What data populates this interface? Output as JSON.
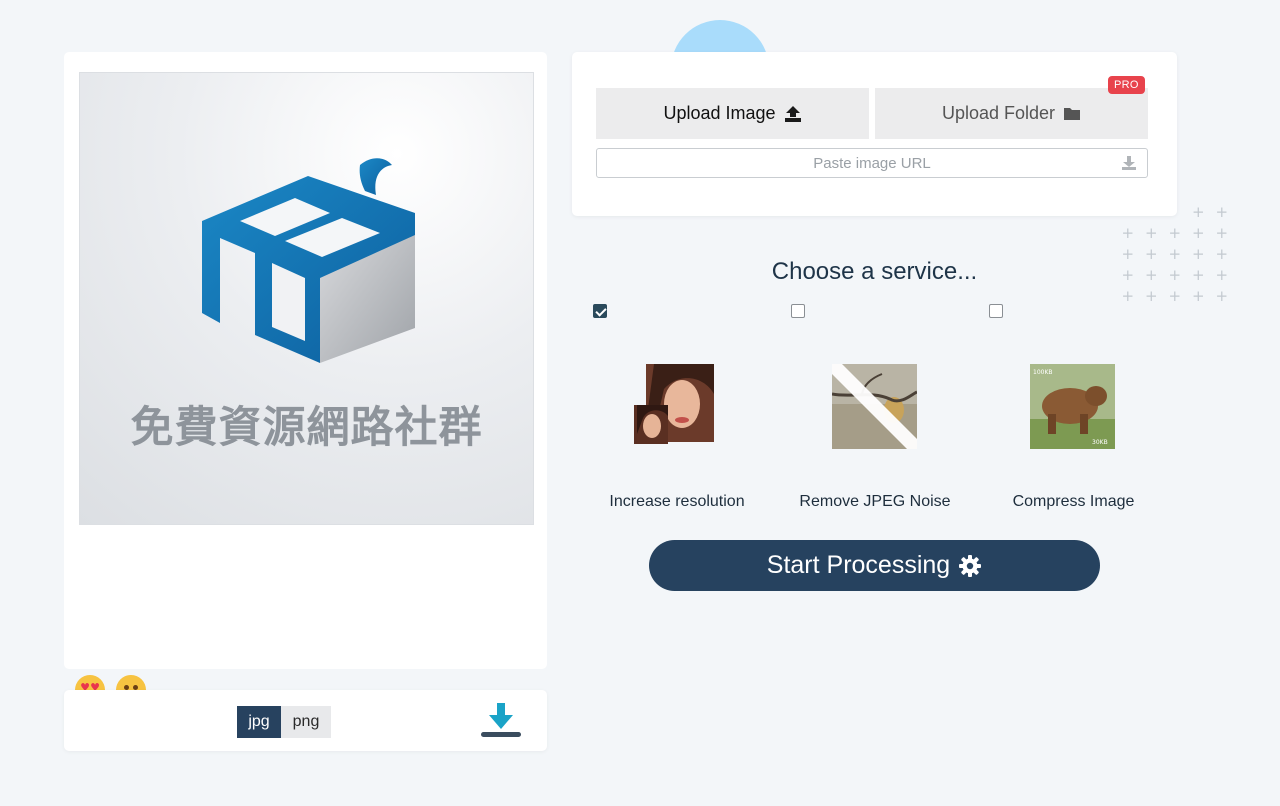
{
  "upload": {
    "image_label": "Upload Image",
    "folder_label": "Upload Folder",
    "pro_badge": "PRO",
    "url_placeholder": "Paste image URL",
    "url_value": ""
  },
  "preview": {
    "caption": "免費資源網路社群"
  },
  "reactions": {
    "love_icon": "heart-eyes-emoji-icon",
    "sad_icon": "slightly-frowning-emoji-icon"
  },
  "format": {
    "options": [
      "jpg",
      "png"
    ],
    "selected": "jpg"
  },
  "services": {
    "title": "Choose a service...",
    "items": [
      {
        "label": "Increase resolution",
        "checked": true
      },
      {
        "label": "Remove JPEG Noise",
        "checked": false
      },
      {
        "label": "Compress Image",
        "checked": false
      }
    ]
  },
  "start_label": "Start Processing",
  "colors": {
    "primary": "#26425f",
    "pro": "#e8434c",
    "download_accent": "#1aa3c7",
    "background": "#f3f6f9"
  }
}
